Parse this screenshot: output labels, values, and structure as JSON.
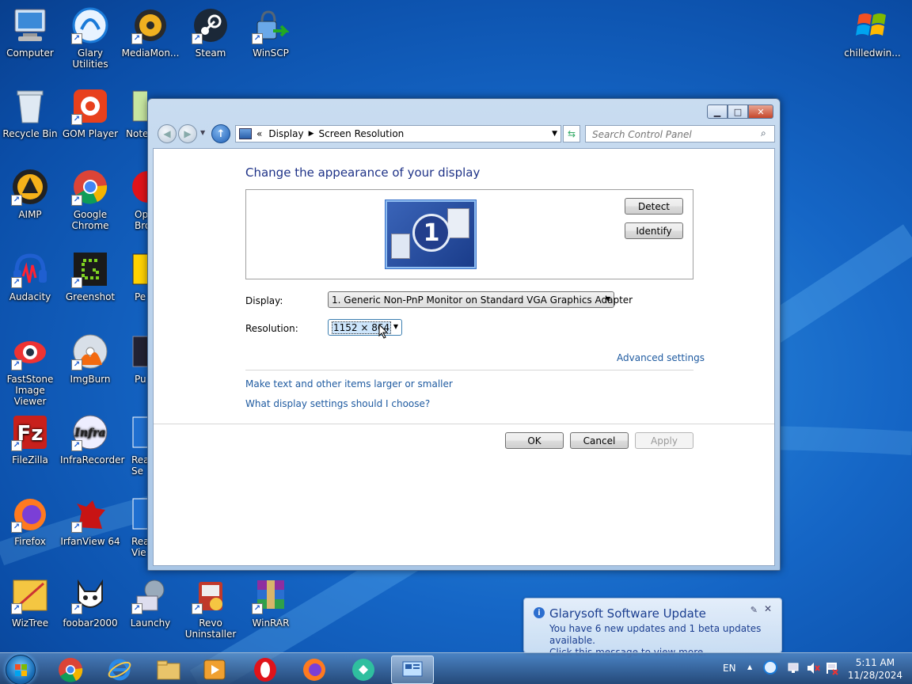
{
  "desktop": {
    "icons": [
      {
        "label": "Computer"
      },
      {
        "label": "Glary Utilities"
      },
      {
        "label": "MediaMon..."
      },
      {
        "label": "Steam"
      },
      {
        "label": "WinSCP"
      },
      {
        "label": "chilledwin..."
      },
      {
        "label": "Recycle Bin"
      },
      {
        "label": "GOM Player"
      },
      {
        "label": "Note"
      },
      {
        "label": "AIMP"
      },
      {
        "label": "Google Chrome"
      },
      {
        "label": "Op Bro"
      },
      {
        "label": "Audacity"
      },
      {
        "label": "Greenshot"
      },
      {
        "label": "Pe"
      },
      {
        "label": "FastStone Image Viewer"
      },
      {
        "label": "ImgBurn"
      },
      {
        "label": "Pu"
      },
      {
        "label": "FileZilla"
      },
      {
        "label": "InfraRecorder"
      },
      {
        "label": "Rea Se"
      },
      {
        "label": "Firefox"
      },
      {
        "label": "IrfanView 64"
      },
      {
        "label": "Rea Vie"
      },
      {
        "label": "WizTree"
      },
      {
        "label": "foobar2000"
      },
      {
        "label": "Launchy"
      },
      {
        "label": "Revo Uninstaller"
      },
      {
        "label": "WinRAR"
      }
    ]
  },
  "window": {
    "address": {
      "prefix": "«",
      "crumb1": "Display",
      "crumb2": "Screen Resolution"
    },
    "search_placeholder": "Search Control Panel",
    "heading": "Change the appearance of your display",
    "monitor_number": "1",
    "detect_label": "Detect",
    "identify_label": "Identify",
    "display_label": "Display:",
    "display_value": "1. Generic Non-PnP Monitor on Standard VGA Graphics Adapter",
    "resolution_label": "Resolution:",
    "resolution_value": "1152 × 864",
    "advanced_link": "Advanced settings",
    "link_text_size": "Make text and other items larger or smaller",
    "link_settings_help": "What display settings should I choose?",
    "ok_label": "OK",
    "cancel_label": "Cancel",
    "apply_label": "Apply"
  },
  "notification": {
    "title": "Glarysoft Software Update",
    "line1": "You have 6 new updates and 1 beta updates available.",
    "line2": "Click this message to view more."
  },
  "taskbar": {
    "language": "EN",
    "time": "5:11 AM",
    "date": "11/28/2024"
  }
}
